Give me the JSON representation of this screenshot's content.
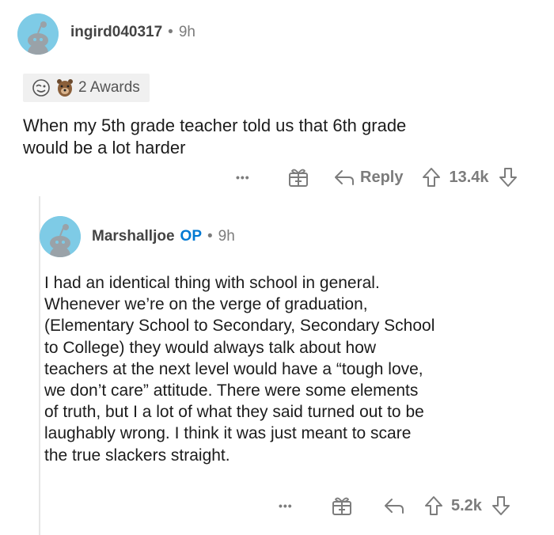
{
  "comment": {
    "username": "ingird040317",
    "separator": "•",
    "time": "9h",
    "awards_label": "2 Awards",
    "body_line1": "When my 5th grade teacher told us that 6th grade",
    "body_line2": "would be a lot harder",
    "more_label": "•••",
    "reply_label": "Reply",
    "vote_count": "13.4k"
  },
  "reply": {
    "username": "Marshalljoe",
    "op_label": "OP",
    "separator": "•",
    "time": "9h",
    "lines": [
      "I had an identical thing with school in general.",
      "Whenever we’re on the verge of graduation,",
      "(Elementary School to Secondary, Secondary School",
      "to College) they would always talk about how",
      "teachers at the next level would have a “tough love,",
      "we don’t care” attitude. There were some elements",
      "of truth, but I a lot of what they said turned out to be",
      "laughably wrong. I think it was just meant to scare",
      "the true slackers straight."
    ],
    "more_label": "•••",
    "vote_count": "5.2k"
  },
  "colors": {
    "avatar_bg": "#7ecbe6",
    "op_blue": "#0079d3",
    "meta_gray": "#7c7c7c"
  }
}
